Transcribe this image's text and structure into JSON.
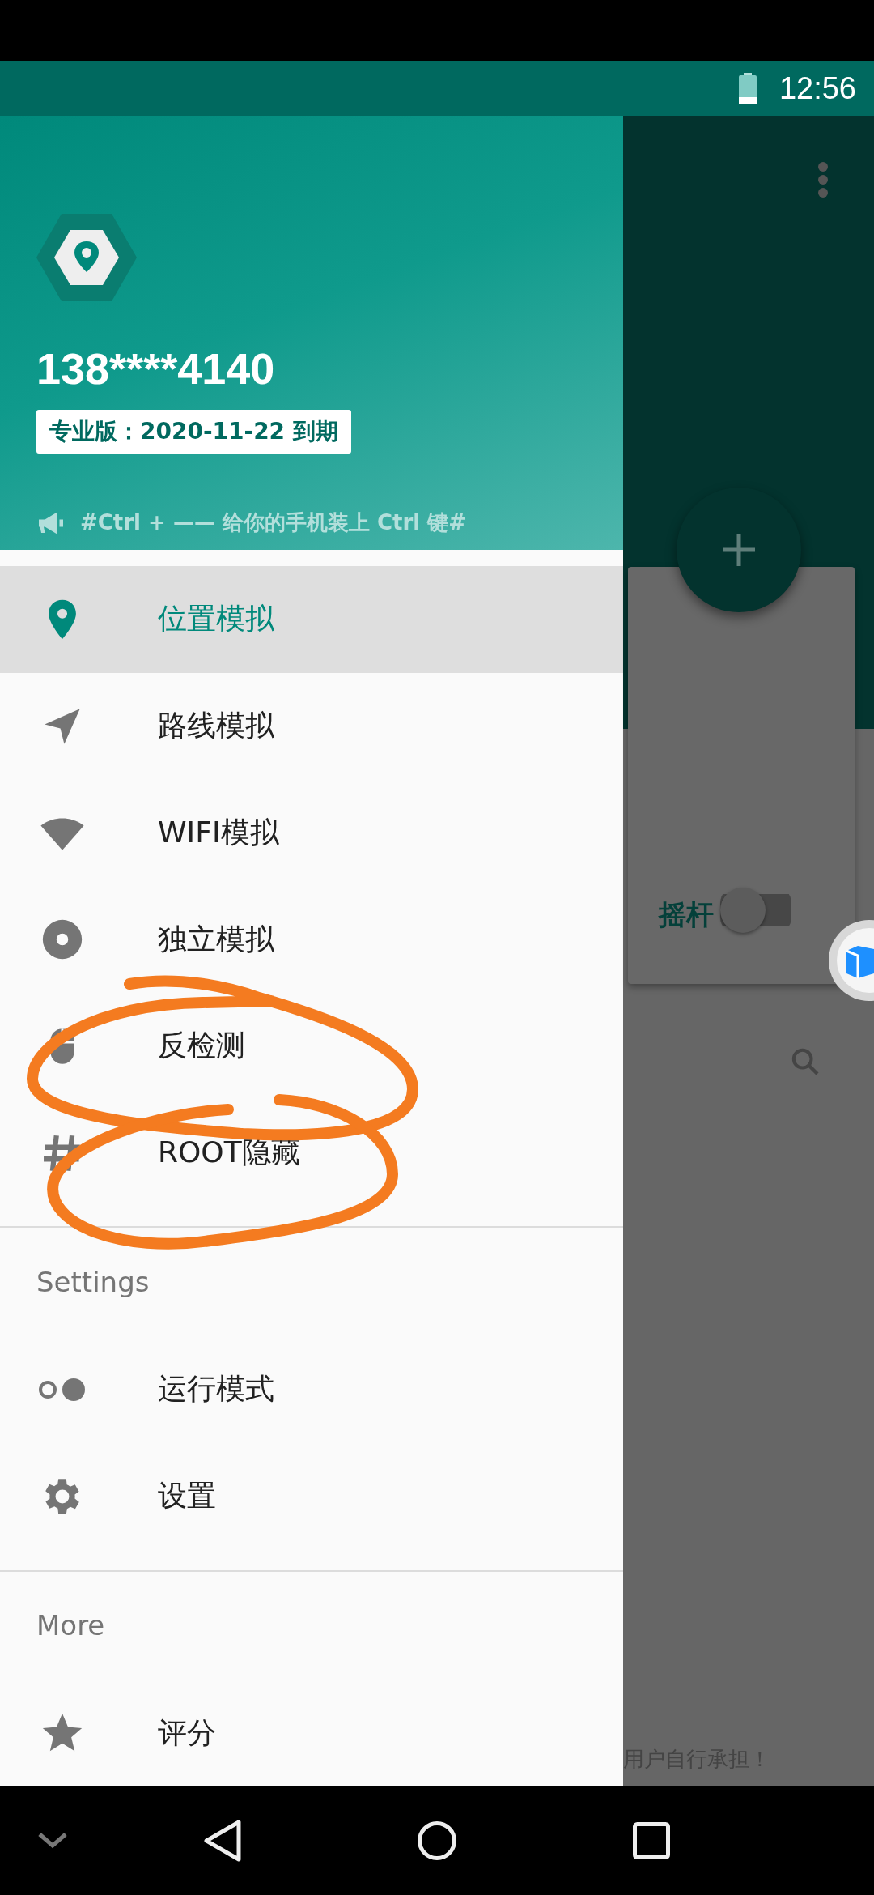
{
  "status_bar": {
    "time": "12:56"
  },
  "drawer": {
    "header": {
      "account": "138****4140",
      "plan_badge": "专业版：2020-11-22 到期",
      "notice": "#Ctrl + —— 给你的手机装上 Ctrl 键#"
    },
    "sections": [
      {
        "items": [
          {
            "kind": "pin",
            "label": "位置模拟",
            "selected": true
          },
          {
            "kind": "navigation",
            "label": "路线模拟",
            "selected": false
          },
          {
            "kind": "wifi",
            "label": "WIFI模拟",
            "selected": false
          },
          {
            "kind": "disc",
            "label": "独立模拟",
            "selected": false
          },
          {
            "kind": "mouse",
            "label": "反检测",
            "selected": false
          },
          {
            "kind": "hash",
            "label": "ROOT隐藏",
            "selected": false
          }
        ]
      },
      {
        "title": "Settings",
        "items": [
          {
            "kind": "dots",
            "label": "运行模式",
            "selected": false
          },
          {
            "kind": "gear",
            "label": "设置",
            "selected": false
          }
        ]
      },
      {
        "title": "More",
        "items": [
          {
            "kind": "star",
            "label": "评分",
            "selected": false
          }
        ]
      }
    ]
  },
  "background": {
    "joystick_label": "摇杆",
    "joystick_on": false,
    "footer_text": "用户自行承担！"
  }
}
